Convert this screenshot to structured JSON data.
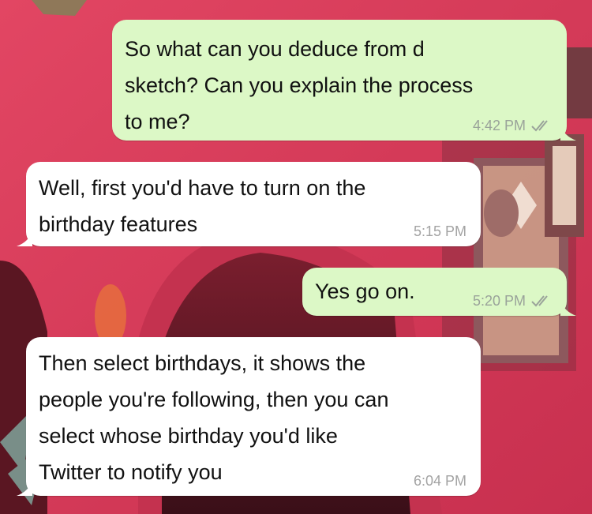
{
  "messages": [
    {
      "direction": "outgoing",
      "text": "So what can you deduce from d\nsketch? Can you explain the process\nto me?",
      "time": "4:42 PM",
      "status_icon": "double-check-icon"
    },
    {
      "direction": "incoming",
      "text": "Well, first you'd have to turn on the\nbirthday features",
      "time": "5:15 PM"
    },
    {
      "direction": "outgoing",
      "text": "Yes go on.",
      "time": "5:20 PM",
      "status_icon": "double-check-icon"
    },
    {
      "direction": "incoming",
      "text": "Then select birthdays, it shows the\npeople you're following, then you can\nselect whose birthday you'd like\nTwitter to notify you",
      "time": "6:04 PM"
    }
  ],
  "colors": {
    "outgoing_bubble": "#dcf8c6",
    "incoming_bubble": "#ffffff",
    "wall": "#d7405a",
    "timestamp": "#9aa39a"
  }
}
